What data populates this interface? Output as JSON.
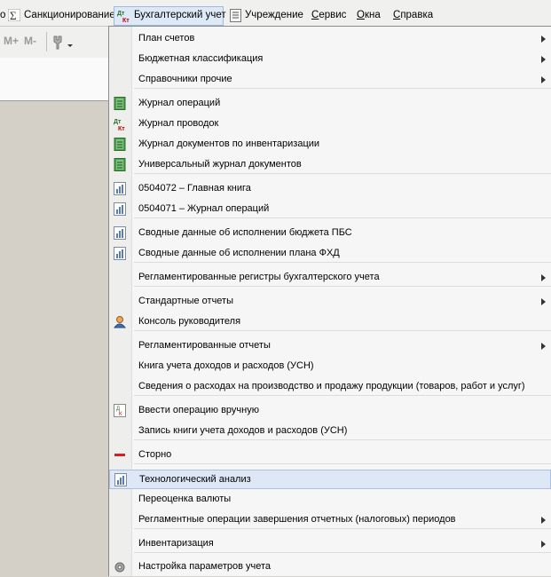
{
  "menubar": {
    "items": [
      {
        "label": "Санкционирование"
      },
      {
        "label": "Бухгалтерский учет"
      },
      {
        "label": "Учреждение"
      },
      {
        "label": "Сервис",
        "u": "С",
        "rest": "ервис"
      },
      {
        "label": "Окна",
        "u": "О",
        "rest": "кна"
      },
      {
        "label": "Справка",
        "u": "С",
        "rest": "правка"
      }
    ]
  },
  "toolbar": {
    "mplus": "M+",
    "mminus": "M-"
  },
  "menu": {
    "items": [
      {
        "label": "План счетов",
        "submenu": true,
        "icon": ""
      },
      {
        "label": "Бюджетная классификация",
        "submenu": true,
        "icon": ""
      },
      {
        "label": "Справочники прочие",
        "submenu": true,
        "icon": ""
      },
      {
        "label": "Журнал операций",
        "submenu": false,
        "icon": "journal-icon"
      },
      {
        "label": "Журнал проводок",
        "submenu": false,
        "icon": "dt-kt-icon"
      },
      {
        "label": "Журнал документов по инвентаризации",
        "submenu": false,
        "icon": "journal-icon"
      },
      {
        "label": "Универсальный журнал документов",
        "submenu": false,
        "icon": "journal-icon"
      },
      {
        "label": "0504072  –  Главная книга",
        "submenu": false,
        "icon": "report-icon"
      },
      {
        "label": "0504071  –  Журнал операций",
        "submenu": false,
        "icon": "report-icon"
      },
      {
        "label": "Сводные данные об исполнении бюджета ПБС",
        "submenu": false,
        "icon": "report-icon"
      },
      {
        "label": "Сводные данные об исполнении плана ФХД",
        "submenu": false,
        "icon": "report-icon"
      },
      {
        "label": "Регламентированные регистры бухгалтерского учета",
        "submenu": true,
        "icon": ""
      },
      {
        "label": "Стандартные отчеты",
        "submenu": true,
        "icon": ""
      },
      {
        "label": "Консоль руководителя",
        "submenu": false,
        "icon": "manager-console-icon"
      },
      {
        "label": "Регламентированные отчеты",
        "submenu": true,
        "icon": ""
      },
      {
        "label": "Книга учета доходов и расходов (УСН)",
        "submenu": false,
        "icon": ""
      },
      {
        "label": "Сведения о расходах на производство и продажу продукции (товаров, работ и услуг)",
        "submenu": false,
        "icon": ""
      },
      {
        "label": "Ввести операцию вручную",
        "submenu": false,
        "icon": "manual-entry-icon"
      },
      {
        "label": "Запись книги учета доходов и расходов (УСН)",
        "submenu": false,
        "icon": ""
      },
      {
        "label": "Сторно",
        "submenu": false,
        "icon": "storno-icon"
      },
      {
        "label": "Технологический анализ",
        "submenu": false,
        "icon": "report-icon",
        "highlighted": true
      },
      {
        "label": "Переоценка валюты",
        "submenu": false,
        "icon": ""
      },
      {
        "label": "Регламентные операции завершения отчетных (налоговых) периодов",
        "submenu": true,
        "icon": ""
      },
      {
        "label": "Инвентаризация",
        "submenu": true,
        "icon": ""
      },
      {
        "label": "Настройка параметров учета",
        "submenu": false,
        "icon": "gear-icon"
      }
    ]
  },
  "colors": {
    "highlight": "#dde7f5",
    "accent": "#a9bfdc"
  }
}
